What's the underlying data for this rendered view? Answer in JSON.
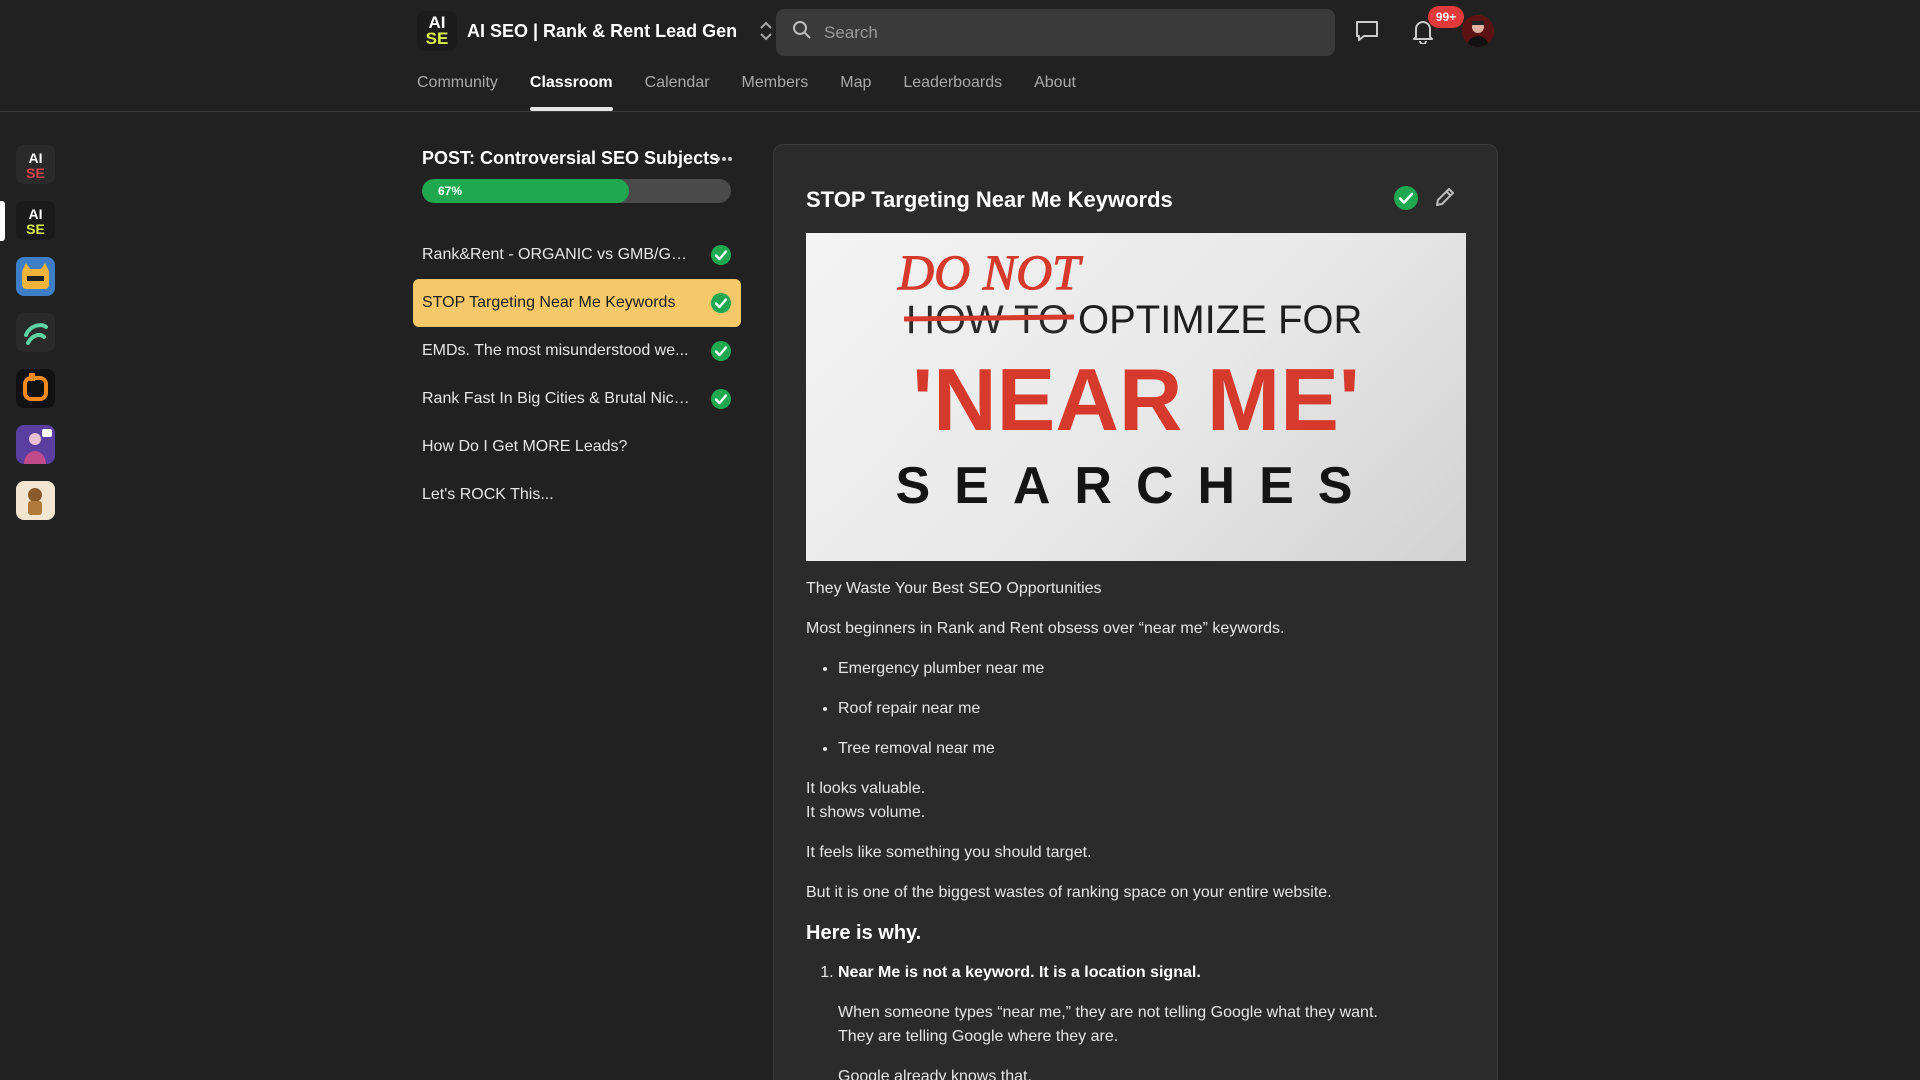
{
  "header": {
    "logo_top": "AI",
    "logo_bottom": "SE",
    "title": "AI SEO | Rank & Rent Lead Gen",
    "search_placeholder": "Search",
    "notifications_badge": "99+"
  },
  "nav": {
    "tabs": [
      {
        "label": "Community",
        "active": false
      },
      {
        "label": "Classroom",
        "active": true
      },
      {
        "label": "Calendar",
        "active": false
      },
      {
        "label": "Members",
        "active": false
      },
      {
        "label": "Map",
        "active": false
      },
      {
        "label": "Leaderboards",
        "active": false
      },
      {
        "label": "About",
        "active": false
      }
    ]
  },
  "rail": {
    "items": [
      {
        "icon": "ai-seo-red-icon"
      },
      {
        "icon": "ai-seo-yellow-icon",
        "active": true
      },
      {
        "icon": "cat-icon"
      },
      {
        "icon": "swirl-icon"
      },
      {
        "icon": "orange-square-icon"
      },
      {
        "icon": "figure-icon"
      },
      {
        "icon": "character-icon"
      }
    ]
  },
  "module": {
    "title": "POST: Controversial SEO Subjects",
    "progress_label": "67%",
    "progress": 0.67,
    "lessons": [
      {
        "title": "Rank&Rent - ORGANIC vs GMB/GBP",
        "done": true
      },
      {
        "title": "STOP Targeting Near Me Keywords",
        "done": true,
        "active": true
      },
      {
        "title": "EMDs. The most misunderstood we...",
        "done": true
      },
      {
        "title": "Rank Fast In Big Cities & Brutal Nich...",
        "done": true
      },
      {
        "title": "How Do I Get MORE Leads?",
        "done": false
      },
      {
        "title": "Let's ROCK This...",
        "done": false
      }
    ]
  },
  "post": {
    "title": "STOP Targeting Near Me Keywords",
    "hero": {
      "line1": "DO NOT",
      "line2_strike": "HOW TO",
      "line2": "OPTIMIZE FOR",
      "line3": "'NEAR ME'",
      "line4": "SEARCHES"
    },
    "intro": "They Waste Your Best SEO Opportunities",
    "p1": "Most beginners in Rank and Rent obsess over “near me” keywords.",
    "bullets": [
      "Emergency plumber near me",
      "Roof repair near me",
      "Tree removal near me"
    ],
    "p2a": "It looks valuable.",
    "p2b": "It shows volume.",
    "p3": "It feels like something you should target.",
    "p4": "But it is one of the biggest wastes of ranking space on your entire website.",
    "heading": "Here is why.",
    "point1_title": "Near Me is not a keyword. It is a location signal.",
    "point1_a": "When someone types “near me,” they are not telling Google what they want.",
    "point1_b": "They are telling Google where they are.",
    "point1_c": "Google already knows that."
  },
  "colors": {
    "background": "#212121",
    "card": "#2b2b2b",
    "accent_green": "#1fa84f",
    "active_lesson": "#f5c96a",
    "hero_red": "#d63a2c"
  }
}
